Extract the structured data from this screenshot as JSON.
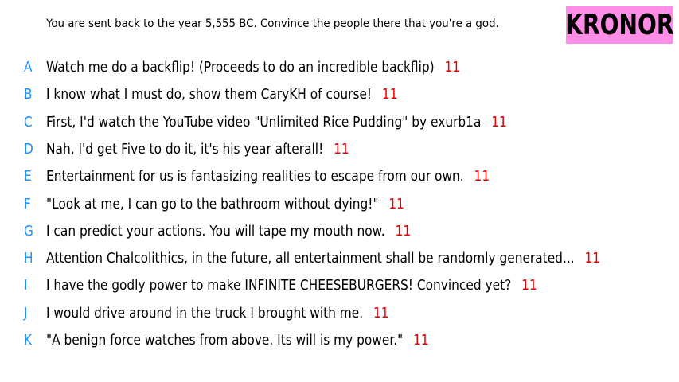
{
  "prompt": "You are sent back to the year 5,555 BC. Convince the people there that you're a god.",
  "player_name": "KRONOR",
  "colors": {
    "letter": "#1e90ff",
    "score": "#e60000",
    "name_background": "#ff8ce6"
  },
  "answers": [
    {
      "letter": "A",
      "text": "Watch me do a backflip! (Proceeds to do an incredible backflip)",
      "score": "11"
    },
    {
      "letter": "B",
      "text": "I know what I must do, show them CaryKH of course!",
      "score": "11"
    },
    {
      "letter": "C",
      "text": "First, I'd watch the YouTube video \"Unlimited Rice Pudding\" by exurb1a",
      "score": "11"
    },
    {
      "letter": "D",
      "text": "Nah, I'd get Five to do it, it's his year afterall!",
      "score": "11"
    },
    {
      "letter": "E",
      "text": "Entertainment for us is fantasizing realities to escape from our own.",
      "score": "11"
    },
    {
      "letter": "F",
      "text": "\"Look at me, I can go to the bathroom without dying!\"",
      "score": "11"
    },
    {
      "letter": "G",
      "text": "I can predict your actions. You will tape my mouth now.",
      "score": "11"
    },
    {
      "letter": "H",
      "text": "Attention Chalcolithics, in the future, all entertainment shall be randomly generated...",
      "score": "11"
    },
    {
      "letter": "I",
      "text": "I have the godly power to make INFINITE CHEESEBURGERS! Convinced yet?",
      "score": "11"
    },
    {
      "letter": "J",
      "text": "I would drive around in the truck I brought with me.",
      "score": "11"
    },
    {
      "letter": "K",
      "text": "\"A benign force watches from above. Its will is my power.\"",
      "score": "11"
    }
  ]
}
